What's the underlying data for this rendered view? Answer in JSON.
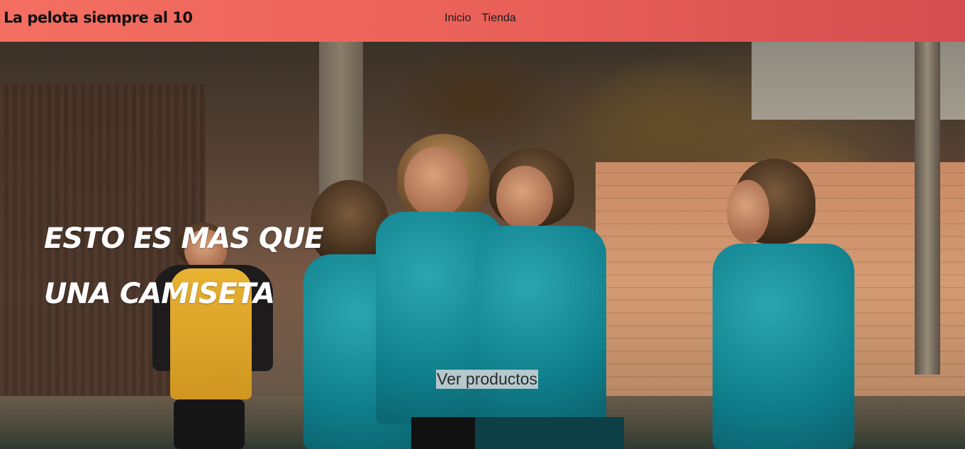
{
  "header": {
    "brand": "La pelota siempre al 10",
    "nav": [
      {
        "label": "Inicio"
      },
      {
        "label": "Tienda"
      }
    ]
  },
  "hero": {
    "title": "Esto es mas que una camiseta",
    "cta_label": "Ver productos",
    "image_subject": "women soccer players celebrating in teal jerseys"
  },
  "colors": {
    "header_start": "#f46e61",
    "header_end": "#d54d4f",
    "hero_text": "#ffffff",
    "jersey_teal": "#0f7f8c"
  }
}
